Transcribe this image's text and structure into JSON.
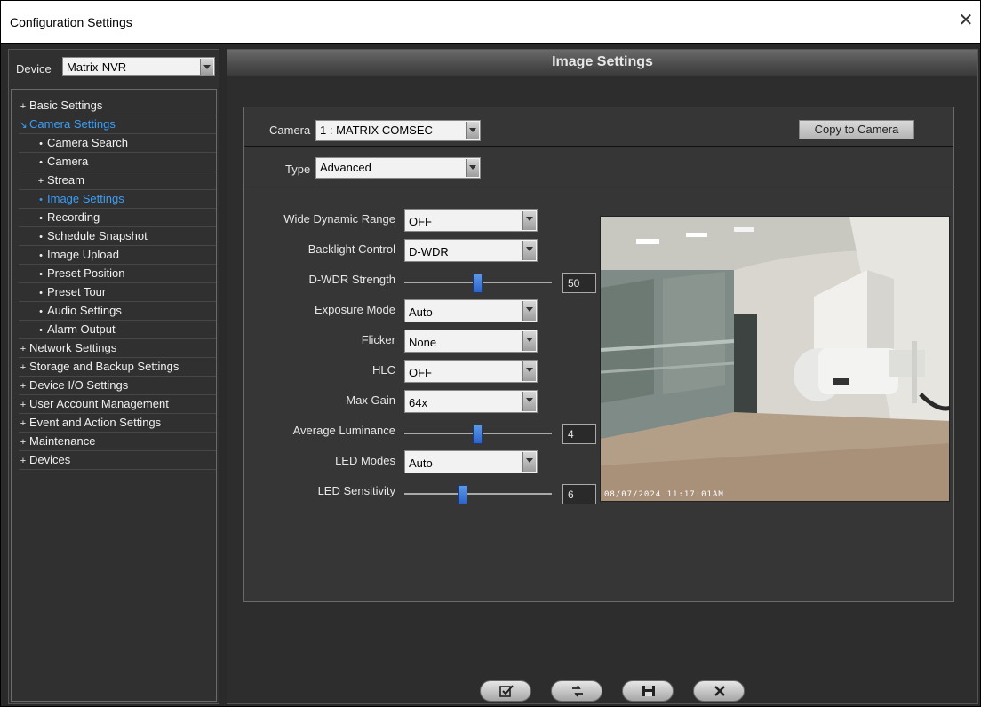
{
  "window": {
    "title": "Configuration Settings",
    "close_glyph": "✕"
  },
  "device": {
    "label": "Device",
    "value": "Matrix-NVR"
  },
  "tree": [
    {
      "label": "Basic Settings",
      "bullet": "+",
      "level": 0
    },
    {
      "label": "Camera Settings",
      "bullet": "↘",
      "level": 0,
      "active": true
    },
    {
      "label": "Camera Search",
      "bullet": "•",
      "level": 1
    },
    {
      "label": "Camera",
      "bullet": "•",
      "level": 1
    },
    {
      "label": "Stream",
      "bullet": "+",
      "level": 1
    },
    {
      "label": "Image Settings",
      "bullet": "•",
      "level": 1,
      "active": true
    },
    {
      "label": "Recording",
      "bullet": "•",
      "level": 1
    },
    {
      "label": "Schedule Snapshot",
      "bullet": "•",
      "level": 1
    },
    {
      "label": "Image Upload",
      "bullet": "•",
      "level": 1
    },
    {
      "label": "Preset Position",
      "bullet": "•",
      "level": 1
    },
    {
      "label": "Preset Tour",
      "bullet": "•",
      "level": 1
    },
    {
      "label": "Audio Settings",
      "bullet": "•",
      "level": 1
    },
    {
      "label": "Alarm Output",
      "bullet": "•",
      "level": 1
    },
    {
      "label": "Network Settings",
      "bullet": "+",
      "level": 0
    },
    {
      "label": "Storage and Backup Settings",
      "bullet": "+",
      "level": 0
    },
    {
      "label": "Device I/O Settings",
      "bullet": "+",
      "level": 0
    },
    {
      "label": "User Account Management",
      "bullet": "+",
      "level": 0
    },
    {
      "label": "Event and Action Settings",
      "bullet": "+",
      "level": 0
    },
    {
      "label": "Maintenance",
      "bullet": "+",
      "level": 0
    },
    {
      "label": "Devices",
      "bullet": "+",
      "level": 0
    }
  ],
  "main": {
    "heading": "Image Settings",
    "camera": {
      "label": "Camera",
      "value": "1 : MATRIX COMSEC"
    },
    "copy_button": "Copy to Camera",
    "type": {
      "label": "Type",
      "value": "Advanced"
    },
    "fields": {
      "wdr": {
        "label": "Wide Dynamic Range",
        "value": "OFF"
      },
      "backlight": {
        "label": "Backlight Control",
        "value": "D-WDR"
      },
      "dwdr_strength": {
        "label": "D-WDR Strength",
        "value": "50",
        "level": 0.5
      },
      "exposure": {
        "label": "Exposure Mode",
        "value": "Auto"
      },
      "flicker": {
        "label": "Flicker",
        "value": "None"
      },
      "hlc": {
        "label": "HLC",
        "value": "OFF"
      },
      "max_gain": {
        "label": "Max Gain",
        "value": "64x"
      },
      "avg_luminance": {
        "label": "Average Luminance",
        "value": "4",
        "level": 0.5
      },
      "led_modes": {
        "label": "LED Modes",
        "value": "Auto"
      },
      "led_sensitivity": {
        "label": "LED Sensitivity",
        "value": "6",
        "level": 0.4
      }
    },
    "preview": {
      "osd": "08/07/2024 11:17:01AM"
    }
  },
  "bottom_buttons": [
    {
      "name": "check-button",
      "icon": "check-icon"
    },
    {
      "name": "refresh-button",
      "icon": "refresh-icon"
    },
    {
      "name": "save-button",
      "icon": "save-icon"
    },
    {
      "name": "close-button",
      "icon": "close-icon"
    }
  ],
  "colors": {
    "accent": "#3a9df6",
    "panel": "#363636",
    "background": "#2a2a2a"
  }
}
